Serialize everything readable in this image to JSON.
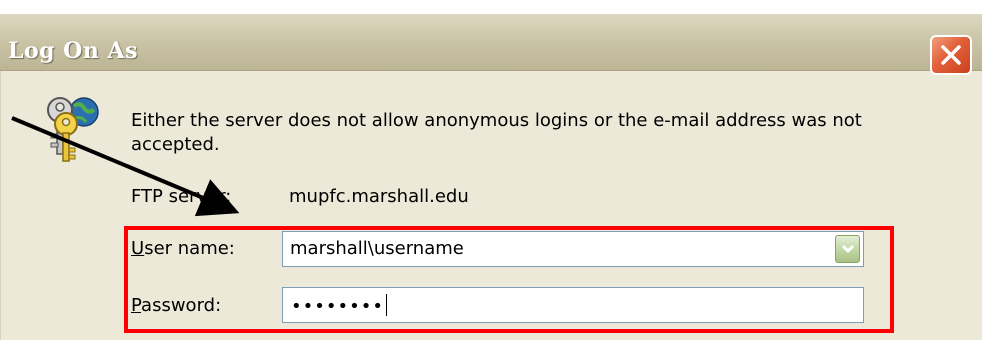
{
  "window": {
    "title": "Log On As"
  },
  "icons": {
    "close": "close-icon",
    "keys": "keys-icon",
    "dropdown": "chevron-down-icon"
  },
  "message": "Either the server does not allow anonymous logins or the e-mail address was not accepted.",
  "ftp_server": {
    "label": "FTP server:",
    "value": "mupfc.marshall.edu"
  },
  "user_name": {
    "label_first": "U",
    "label_rest": "ser name:",
    "value": "marshall\\username"
  },
  "password": {
    "label_first": "P",
    "label_rest": "assword:",
    "masked_value": "••••••••"
  },
  "colors": {
    "highlight": "#ff0000",
    "dialog_bg": "#ece9d8",
    "close_button": "#e2603a"
  }
}
